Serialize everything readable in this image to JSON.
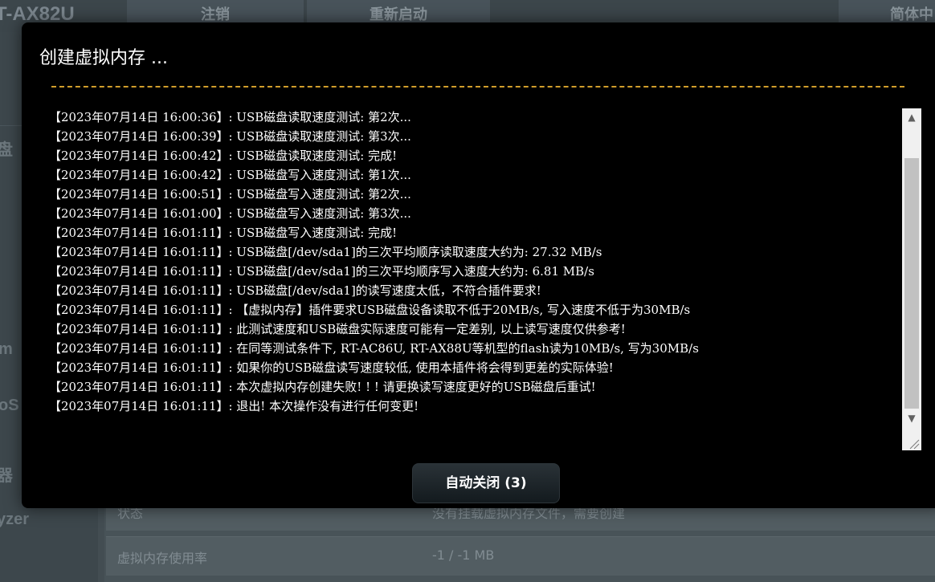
{
  "background": {
    "model": "T-AX82U",
    "top_buttons": [
      "注销",
      "重新启动",
      "简体中"
    ],
    "side_items": [
      "盘",
      "m",
      "oS",
      "器",
      "yzer"
    ],
    "rows": [
      {
        "label": "状态",
        "value": "没有挂载虚拟内存文件，需要创建"
      },
      {
        "label": "虚拟内存使用率",
        "value": "-1 / -1 MB"
      }
    ]
  },
  "modal": {
    "title": "创建虚拟内存 ...",
    "log_lines": [
      "【2023年07月14日 16:00:36】: USB磁盘读取速度测试: 第2次...",
      "【2023年07月14日 16:00:39】: USB磁盘读取速度测试: 第3次...",
      "【2023年07月14日 16:00:42】: USB磁盘读取速度测试: 完成!",
      "【2023年07月14日 16:00:42】: USB磁盘写入速度测试: 第1次...",
      "【2023年07月14日 16:00:51】: USB磁盘写入速度测试: 第2次...",
      "【2023年07月14日 16:01:00】: USB磁盘写入速度测试: 第3次...",
      "【2023年07月14日 16:01:11】: USB磁盘写入速度测试: 完成!",
      "【2023年07月14日 16:01:11】: USB磁盘[/dev/sda1]的三次平均顺序读取速度大约为: 27.32 MB/s",
      "【2023年07月14日 16:01:11】: USB磁盘[/dev/sda1]的三次平均顺序写入速度大约为: 6.81 MB/s",
      "【2023年07月14日 16:01:11】: USB磁盘[/dev/sda1]的读写速度太低，不符合插件要求!",
      "【2023年07月14日 16:01:11】: 【虚拟内存】插件要求USB磁盘设备读取不低于20MB/s, 写入速度不低于为30MB/s",
      "【2023年07月14日 16:01:11】: 此测试速度和USB磁盘实际速度可能有一定差别, 以上读写速度仅供参考!",
      "【2023年07月14日 16:01:11】: 在同等测试条件下, RT-AC86U, RT-AX88U等机型的flash读为10MB/s, 写为30MB/s",
      "【2023年07月14日 16:01:11】: 如果你的USB磁盘读写速度较低, 使用本插件将会得到更差的实际体验!",
      "【2023年07月14日 16:01:11】: 本次虚拟内存创建失败! ! ! 请更换读写速度更好的USB磁盘后重试!",
      "【2023年07月14日 16:01:11】: 退出! 本次操作没有进行任何变更!"
    ],
    "close_button": "自动关闭 (3)"
  },
  "colors": {
    "modal_bg": "#000000",
    "divider": "#d19e2b",
    "text": "#ffffff"
  },
  "icons": {
    "scroll_up": "triangle-up-icon",
    "scroll_down": "triangle-down-icon",
    "resize": "resize-grip-icon"
  }
}
